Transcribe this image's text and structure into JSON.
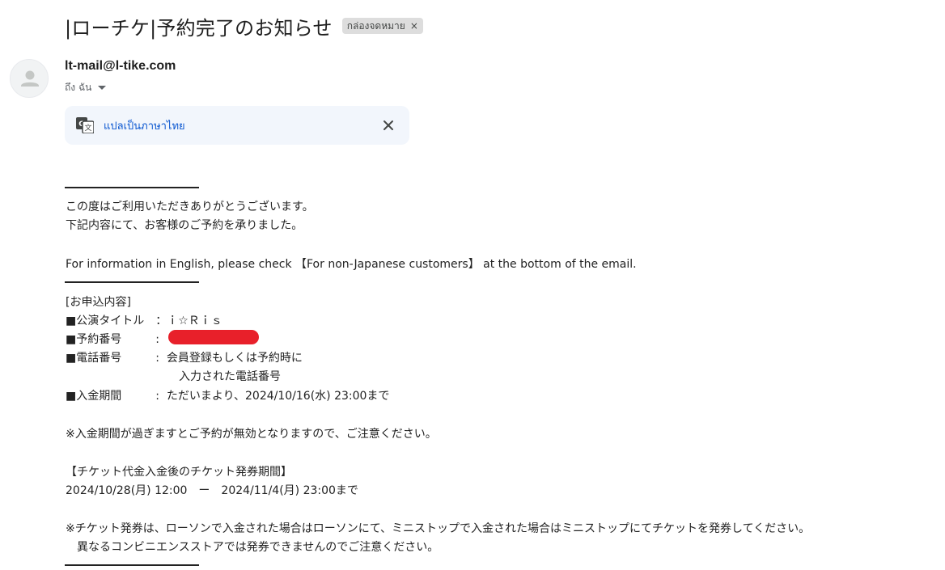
{
  "email": {
    "subject": "|ローチケ|予約完了のお知らせ",
    "label_chip": "กล่องจดหมาย",
    "label_chip_close": "×",
    "sender": "lt-mail@l-tike.com",
    "recipient": "ถึง ฉัน",
    "translate_link": "แปลเป็นภาษาไทย",
    "avatar_icon": "person-icon",
    "translate_icon": "translate-icon",
    "close_icon": "close-icon"
  },
  "body": {
    "greeting_1": "この度はご利用いただきありがとうございます。",
    "greeting_2": "下記内容にて、お客様のご予約を承りました。",
    "english_note": "For information in English, please check 【For non-Japanese customers】 at the bottom of the email.",
    "section_header": "[お申込内容]",
    "title_row": "■公演タイトル　：ｉ☆Ｒｉｓ",
    "reservation_row": "■予約番号　　　:",
    "phone_row_1": "■電話番号　　　:  会員登録もしくは予約時に",
    "phone_row_2": "　　　　　　　　　　入力された電話番号",
    "deadline_row": "■入金期間　　　:  ただいまより、2024/10/16(水) 23:00まで",
    "warning": "※入金期間が過ぎますとご予約が無効となりますので、ご注意ください。",
    "ticket_period_header": "【チケット代金入金後のチケット発券期間】",
    "ticket_period": "2024/10/28(月) 12:00　ー　2024/11/4(月) 23:00まで",
    "issue_note_1": "※チケット発券は、ローソンで入金された場合はローソンにて、ミニストップで入金された場合はミニストップにてチケットを発券してください。",
    "issue_note_2": "　異なるコンビニエンスストアでは発券できませんのでご注意ください。"
  },
  "colors": {
    "link": "#0b57d0",
    "translate_bg": "#f2f6fc",
    "redaction": "#e8202a",
    "chip_bg": "#dddddd"
  }
}
